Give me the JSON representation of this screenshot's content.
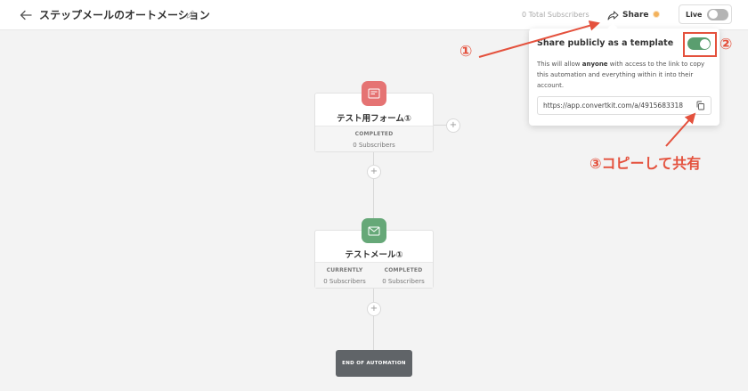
{
  "header": {
    "title": "ステップメールのオートメーション",
    "subscribers": "0 Total Subscribers",
    "share_label": "Share",
    "live_label": "Live"
  },
  "share_popover": {
    "title": "Share publicly as a template",
    "desc_pre": "This will allow ",
    "desc_bold": "anyone",
    "desc_post": " with access to the link to copy this automation and everything within it into their account.",
    "url": "https://app.convertkit.com/a/4915683318",
    "template_enabled": true
  },
  "flow": {
    "form_node": {
      "title": "テスト用フォーム①",
      "stat_label": "COMPLETED",
      "stat_value": "0 Subscribers"
    },
    "email_node": {
      "title": "テストメール①",
      "stats": [
        {
          "label": "CURRENTLY",
          "value": "0 Subscribers"
        },
        {
          "label": "COMPLETED",
          "value": "0 Subscribers"
        }
      ]
    },
    "plus": "+",
    "end_label": "END OF AUTOMATION"
  },
  "annotations": {
    "a1": "①",
    "a2": "②",
    "a3": "③コピーして共有"
  },
  "colors": {
    "accent_red": "#e4513d",
    "toggle_green": "#5a9e6f",
    "form_icon": "#e57373",
    "email_icon": "#66a878"
  }
}
